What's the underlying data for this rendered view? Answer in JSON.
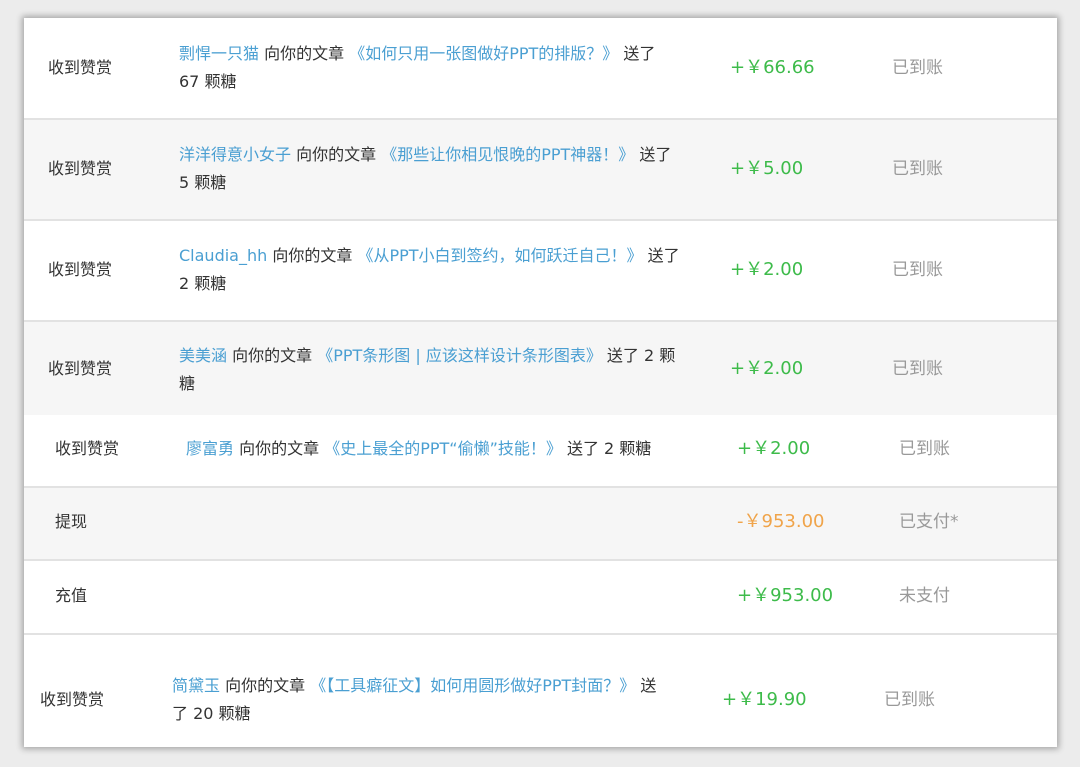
{
  "rows": [
    {
      "type": "收到赞赏",
      "sender": "剽悍一只猫",
      "mid": " 向你的文章 ",
      "article": "《如何只用一张图做好PPT的排版？》",
      "tail": " 送了",
      "tail2": "67 颗糖",
      "amount": "+￥66.66",
      "status": "已到账"
    },
    {
      "type": "收到赞赏",
      "sender": "洋洋得意小女子",
      "mid": " 向你的文章 ",
      "article": "《那些让你相见恨晚的PPT神器！》",
      "tail": " 送了",
      "tail2": "5 颗糖",
      "amount": "+￥5.00",
      "status": "已到账"
    },
    {
      "type": "收到赞赏",
      "sender": "Claudia_hh",
      "mid": " 向你的文章 ",
      "article": "《从PPT小白到签约，如何跃迁自己！》",
      "tail": " 送了",
      "tail2": "2 颗糖",
      "amount": "+￥2.00",
      "status": "已到账"
    },
    {
      "type": "收到赞赏",
      "sender": "美美涵",
      "mid": " 向你的文章 ",
      "article": "《PPT条形图 | 应该这样设计条形图表》",
      "tail": " 送了 2 颗",
      "tail2": "糖",
      "amount": "+￥2.00",
      "status": "已到账"
    },
    {
      "type": "收到赞赏",
      "sender": "廖富勇",
      "mid": " 向你的文章 ",
      "article": "《史上最全的PPT“偷懒”技能！》",
      "tail": " 送了 2 颗糖",
      "amount": "+￥2.00",
      "status": "已到账"
    },
    {
      "type": "提现",
      "amount": "-￥953.00",
      "status": "已支付*"
    },
    {
      "type": "充值",
      "amount": "+￥953.00",
      "status": "未支付"
    },
    {
      "type": "收到赞赏",
      "sender": "简黛玉",
      "mid": " 向你的文章 ",
      "article": "《【工具癖征文】如何用圆形做好PPT封面？》",
      "tail": " 送",
      "tail2": "了 20 颗糖",
      "amount": "+￥19.90",
      "status": "已到账"
    }
  ]
}
